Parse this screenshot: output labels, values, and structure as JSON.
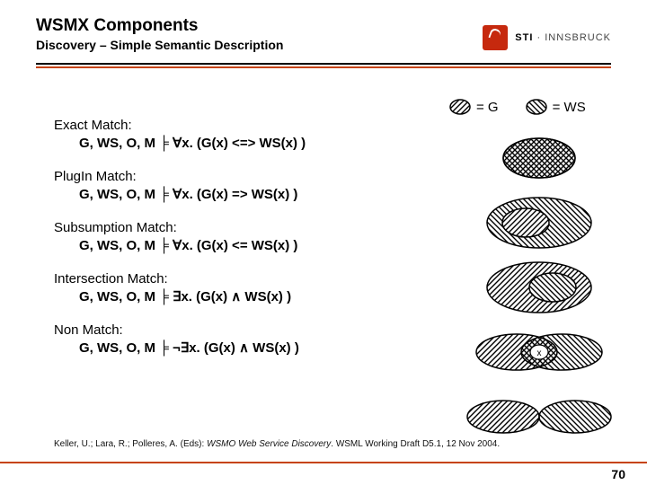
{
  "header": {
    "title": "WSMX Components",
    "subtitle": "Discovery – Simple Semantic Description"
  },
  "logo": {
    "org": "STI",
    "sep": " · ",
    "place": "INNSBRUCK"
  },
  "legend": {
    "g": "= G",
    "ws": "= WS"
  },
  "matches": [
    {
      "title": "Exact Match:",
      "formula": "G, WS, O, M ╞ ∀x. (G(x) <=> WS(x) )"
    },
    {
      "title": "PlugIn Match:",
      "formula": "G, WS, O, M ╞ ∀x. (G(x) => WS(x) )"
    },
    {
      "title": "Subsumption Match:",
      "formula": "G, WS, O, M ╞ ∀x. (G(x) <= WS(x) )"
    },
    {
      "title": "Intersection Match:",
      "formula": "G, WS, O, M ╞ ∃x. (G(x) ∧ WS(x) )"
    },
    {
      "title": "Non Match:",
      "formula": "G, WS, O, M ╞ ¬∃x. (G(x) ∧ WS(x) )"
    }
  ],
  "citation": {
    "authors": "Keller, U.; Lara, R.; Polleres, A. (Eds): ",
    "title": "WSMO Web Service Discovery",
    "tail": ". WSML Working Draft D5.1, 12 Nov 2004."
  },
  "page": "70",
  "colors": {
    "accent": "#c6430b"
  }
}
